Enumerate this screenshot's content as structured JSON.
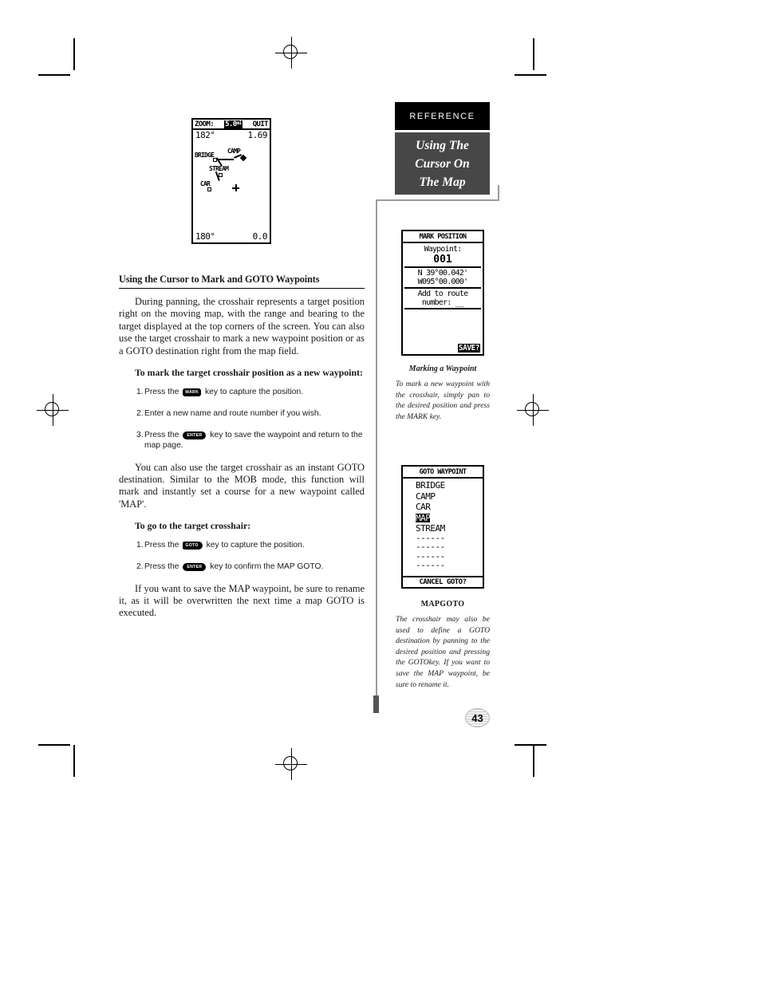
{
  "sidebar": {
    "ref_label": "REFERENCE",
    "section_title_lines": [
      "Using The",
      "Cursor On",
      "The Map"
    ]
  },
  "map_screen": {
    "zoom_label": "ZOOM:",
    "zoom_value": "5.0",
    "zoom_unit": "mi",
    "quit_label": "QUIT",
    "bearing_top": "182°",
    "range_top": "1.69",
    "bearing_bottom": "180°",
    "range_bottom": "0.0",
    "waypoints": [
      "BRIDGE",
      "CAMP",
      "STREAM",
      "CAR"
    ],
    "cursor": "+"
  },
  "mark_screen": {
    "header": "MARK POSITION",
    "waypoint_label": "Waypoint:",
    "waypoint_name": "001",
    "latitude": "N  39°00.042'",
    "longitude": "W095°00.000'",
    "route_label_line1": "Add to route",
    "route_label_line2": "number: __",
    "save_label": "SAVE?"
  },
  "goto_screen": {
    "header": "GOTO WAYPOINT",
    "waypoints": [
      "BRIDGE",
      "CAMP",
      "CAR",
      "MAP",
      "STREAM"
    ],
    "selected": "MAP",
    "empty_slots": [
      "------",
      "------",
      "------",
      "------"
    ],
    "cancel_label": "CANCEL GOTO?"
  },
  "captions": {
    "mark": {
      "title": "Marking a Waypoint",
      "body": "To mark a new waypoint with the crosshair, simply pan to the desired position and press the MARK key."
    },
    "goto": {
      "title": "MAPGOTO",
      "body": "The crosshair may also be used to define a GOTO destination by panning to the desired position and pressing the GOTOkey. If you want to save the MAP waypoint, be sure to rename it."
    }
  },
  "main": {
    "heading": "Using the Cursor to Mark and GOTO Waypoints",
    "para1": "During panning, the crosshair represents a target position right on the moving map, with the range and bearing to the target displayed at the top corners of the screen. You can also use the target crosshair to mark a new waypoint position or as a GOTO destination right from the map field.",
    "subhead1": "To mark the target crosshair position as a new waypoint:",
    "steps1": [
      {
        "num": "1.",
        "before": "Press the ",
        "key": "MARK",
        "after": " key to capture the position."
      },
      {
        "num": "2.",
        "before": "Enter a new name and route number if you wish.",
        "key": "",
        "after": ""
      },
      {
        "num": "3.",
        "before": "Press the ",
        "key": "ENTER",
        "after": " key to save the waypoint and return to the map page."
      }
    ],
    "para2": "You can also use the target crosshair as an instant GOTO destination. Similar to the MOB mode, this function will mark and instantly set a course for a new waypoint called 'MAP'.",
    "subhead2": "To go to the target crosshair:",
    "steps2": [
      {
        "num": "1.",
        "before": "Press the ",
        "key": "GOTO",
        "after": " key to capture the position."
      },
      {
        "num": "2.",
        "before": "Press the ",
        "key": "ENTER",
        "after": " key to confirm the MAP GOTO."
      }
    ],
    "para3": "If you want to save the MAP waypoint, be sure to rename it, as it will be overwritten the next time a map GOTO is executed."
  },
  "page_number": "43"
}
